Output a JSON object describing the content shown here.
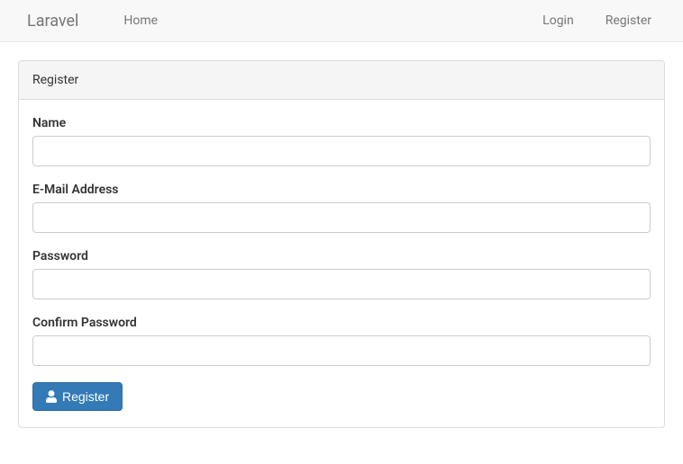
{
  "navbar": {
    "brand": "Laravel",
    "home_label": "Home",
    "login_label": "Login",
    "register_label": "Register"
  },
  "panel": {
    "heading": "Register"
  },
  "form": {
    "name_label": "Name",
    "name_value": "",
    "email_label": "E-Mail Address",
    "email_value": "",
    "password_label": "Password",
    "password_value": "",
    "confirm_password_label": "Confirm Password",
    "confirm_password_value": "",
    "submit_label": "Register"
  }
}
